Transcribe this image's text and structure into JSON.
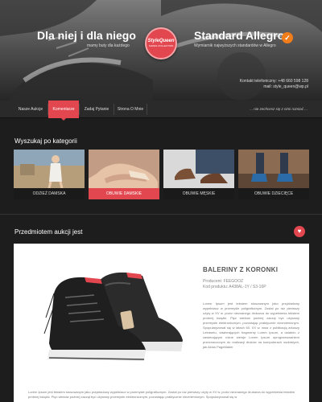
{
  "header": {
    "tagline_left": "Dla niej i dla niego",
    "tagline_left_sub": "mamy buty dla każdego",
    "logo_text": "StyleQueen",
    "logo_sub": "SHOES COLLECTION",
    "tagline_right": "Standard Allegro",
    "tagline_right_sub": "Wymiarnik najwyższych standardów w Allegro",
    "check_icon": "✓",
    "contact_phone": "Kontakt telefoniczny: +48 660 598 128",
    "contact_mail": "mail: style_queen@wp.pl"
  },
  "nav": {
    "items": [
      {
        "label": "Nasze Aukcje"
      },
      {
        "label": "Komentarze"
      },
      {
        "label": "Zadaj Pytanie"
      },
      {
        "label": "Strona O Mnie"
      }
    ],
    "active_index": 1,
    "right_text": "... nie zechcesz się z nimi rozstać ..."
  },
  "categories": {
    "title": "Wyszukaj po kategorii",
    "items": [
      {
        "label": "ODZIEŻ DAMSKA"
      },
      {
        "label": "OBUWIE DAMSKIE"
      },
      {
        "label": "OBUWIE MĘSKIE"
      },
      {
        "label": "OBUWIE DZIECIĘCE"
      }
    ],
    "active_index": 1
  },
  "auction": {
    "title": "Przedmiotem aukcji jest",
    "icon": "♥",
    "product_title": "BALERINY Z KORONKI",
    "producer": "Producent: FEEGOOZ",
    "product_code": "Kod produktu: A438AL-1Y / S3-16P",
    "description": "Lorem Ipsum jest tekstem stosowanym jako przykładowy wypełniacz w przemyśle poligraficznym. Został po raz pierwszy użyty w XV w. przez nieznanego drukarza do wypełnienia tekstem próbnej książki. Pięć wieków później zaczął być używany przemyśle elektronicznym, pozostając praktycznie niezmienionym. Spopularyzował się w latach 60. XX w. wraz z publikacją arkuszy Letrasetu, zawierających fragmenty Lorem Ipsum, a ostatnio z zawierającym różne wersje Lorem Ipsum oprogramowaniem przeznaczonym do realizacji druków na komputerach osobistych, jak Aldus PageMaker",
    "bottom_text": "Lorem Ipsum jest tekstem stosowanym jako przykładowy wypełniacz w przemyśle poligraficznym. Został po raz pierwszy użyty w XV w. przez nieznanego drukarza do wypełnienia tekstem próbnej książki. Pięć wieków później zaczął być używany przemyśle elektronicznym, pozostając praktycznie niezmienionym. Spopularyzował się w"
  },
  "colors": {
    "accent": "#e2474f",
    "check": "#f07d1a",
    "background": "#1d1d1d"
  }
}
